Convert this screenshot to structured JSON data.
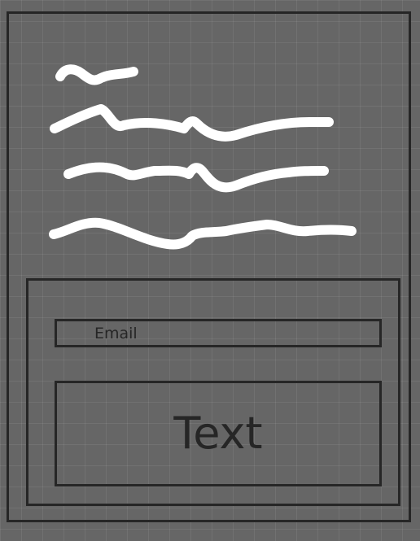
{
  "colors": {
    "background": "#666666",
    "outline": "#262626",
    "scribble": "#ffffff"
  },
  "form": {
    "email_placeholder": "Email",
    "text_area_label": "Text"
  }
}
